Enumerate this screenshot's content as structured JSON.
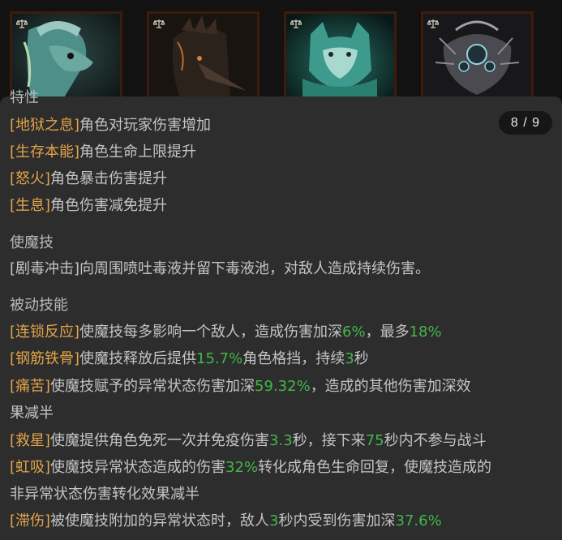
{
  "page_indicator": "8 / 9",
  "portraits": [
    {
      "name": "fish-creature-portrait",
      "palette": {
        "bg": "#1b2a2a",
        "main": "#4f8f8a",
        "accent": "#9ac8c0"
      }
    },
    {
      "name": "crow-creature-portrait",
      "palette": {
        "bg": "#1c1410",
        "main": "#3a2c22",
        "accent": "#c06a2a"
      }
    },
    {
      "name": "cat-creature-portrait",
      "palette": {
        "bg": "#0f2422",
        "main": "#3d9a8c",
        "accent": "#a8d8d0"
      }
    },
    {
      "name": "spider-creature-portrait",
      "palette": {
        "bg": "#1a1a1c",
        "main": "#6a6a70",
        "accent": "#8fd3e0"
      }
    }
  ],
  "traits": {
    "heading": "特性",
    "items": [
      {
        "tag": "[地狱之息]",
        "text": "角色对玩家伤害增加"
      },
      {
        "tag": "[生存本能]",
        "text": "角色生命上限提升"
      },
      {
        "tag": "[怒火]",
        "text": "角色暴击伤害提升"
      },
      {
        "tag": "[生息]",
        "text": "角色伤害减免提升"
      }
    ]
  },
  "demon_skill": {
    "heading": "使魔技",
    "text": "[剧毒冲击]向周围喷吐毒液并留下毒液池，对敌人造成持续伤害。"
  },
  "passive_skills": {
    "heading": "被动技能",
    "items": [
      {
        "tag": "[连锁反应]",
        "parts": [
          "使魔技每多影响一个敌人，造成伤害加深",
          "6%",
          "，最多",
          "18%"
        ]
      },
      {
        "tag": "[钢筋铁骨]",
        "parts": [
          "使魔技释放后提供",
          "15.7%",
          "角色格挡，持续",
          "3",
          "秒"
        ]
      },
      {
        "tag": "[痛苦]",
        "parts": [
          "使魔技赋予的异常状态伤害加深",
          "59.32%",
          "，造成的其他伤害加深效"
        ],
        "line2": "果减半"
      },
      {
        "tag": "[救星]",
        "parts": [
          "使魔提供角色免死一次并免疫伤害",
          "3.3",
          "秒，接下来",
          "75",
          "秒内不参与战斗"
        ]
      },
      {
        "tag": "[虹吸]",
        "parts": [
          "使魔技异常状态造成的伤害",
          "32%",
          "转化成角色生命回复，使魔技造成的"
        ],
        "line2": "非异常状态伤害转化效果减半"
      },
      {
        "tag": "[滞伤]",
        "parts": [
          "被使魔技附加的异常状态时，敌人",
          "3",
          "秒内受到伤害加深",
          "37.6%"
        ]
      }
    ]
  },
  "colors": {
    "tag": "#e2a44a",
    "highlight": "#43b649",
    "text": "#c4c4c4",
    "panel": "#2d2d2d"
  }
}
